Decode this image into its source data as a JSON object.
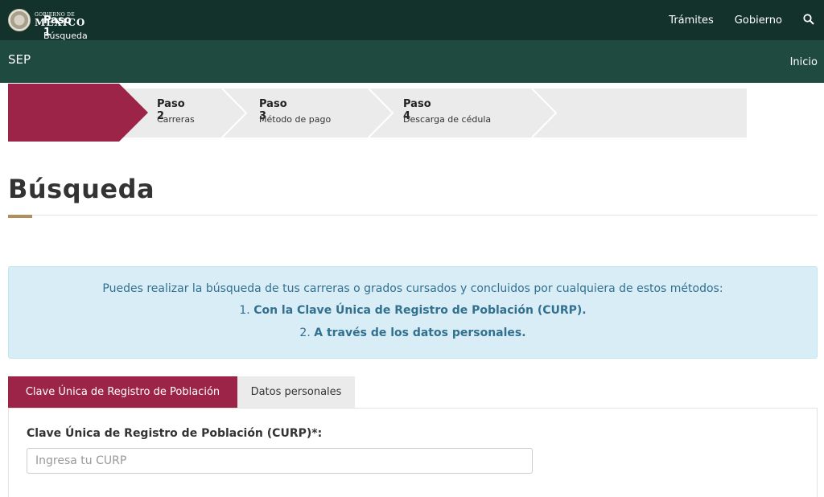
{
  "gov_header": {
    "logo_small": "GOBIERNO DE",
    "logo_big": "MÉXICO",
    "nav": [
      "Trámites",
      "Gobierno"
    ],
    "search_icon": "search-icon"
  },
  "sep_bar": {
    "title": "SEP",
    "home_link": "Inicio"
  },
  "steps": [
    {
      "label": "Paso 1",
      "sub": "Búsqueda",
      "active": true
    },
    {
      "label": "Paso 2",
      "sub": "Carreras",
      "active": false
    },
    {
      "label": "Paso 3",
      "sub": "Método de pago",
      "active": false
    },
    {
      "label": "Paso 4",
      "sub": "Descarga de cédula",
      "active": false
    }
  ],
  "page": {
    "title": "Búsqueda"
  },
  "info": {
    "line1": "Puedes realizar la búsqueda de tus carreras o grados cursados y concluidos por cualquiera de estos métodos:",
    "item1_num": "1.",
    "item1_text": "Con la Clave Única de Registro de Población (CURP).",
    "item2_num": "2.",
    "item2_text": "A través de los datos personales."
  },
  "tabs": [
    {
      "label": "Clave Única de Registro de Población",
      "active": true
    },
    {
      "label": "Datos personales",
      "active": false
    }
  ],
  "form": {
    "curp_label": "Clave Única de Registro de Población (CURP)*:",
    "curp_placeholder": "Ingresa tu CURP",
    "curp_value": ""
  },
  "colors": {
    "gov_bar": "#13322b",
    "sep_bar": "#1f4a3f",
    "accent": "#9d2449",
    "gold": "#b38e5d",
    "info_bg": "#d9edf7",
    "info_text": "#31708f"
  }
}
